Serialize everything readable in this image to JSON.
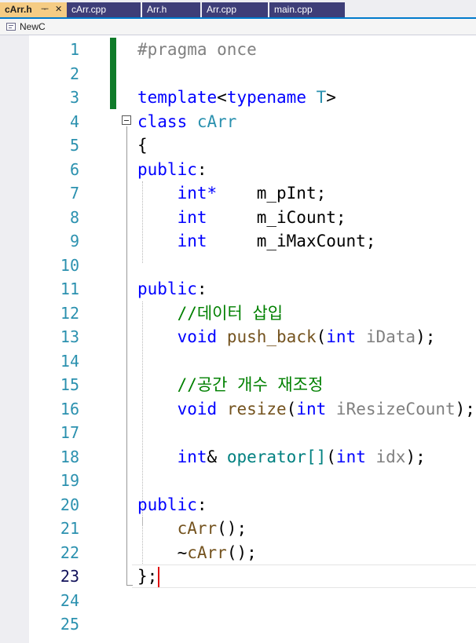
{
  "tabs": [
    {
      "label": "cArr.h",
      "pin": "ᅮ",
      "close": "✕",
      "active": true
    },
    {
      "label": "cArr.cpp",
      "active": false
    },
    {
      "label": "Arr.h",
      "active": false
    },
    {
      "label": "Arr.cpp",
      "active": false
    },
    {
      "label": "main.cpp",
      "active": false
    }
  ],
  "nav": {
    "scope": "NewC",
    "icon": "class-scope-icon"
  },
  "editor": {
    "current_line": 23,
    "line_numbers": [
      "1",
      "2",
      "3",
      "4",
      "5",
      "6",
      "7",
      "8",
      "9",
      "10",
      "11",
      "12",
      "13",
      "14",
      "15",
      "16",
      "17",
      "18",
      "19",
      "20",
      "21",
      "22",
      "23",
      "24",
      "25"
    ],
    "code": {
      "pragma": "#pragma once",
      "l3_template": "template",
      "l3_lt": "<",
      "l3_typename": "typename",
      "l3_T": "T",
      "l3_gt": ">",
      "l4_class": "class",
      "l4_name": "cArr",
      "l5": "{",
      "l6_public": "public",
      "colon": ":",
      "l7_type": "int*",
      "l7_name": "m_pInt;",
      "l8_type": "int",
      "l8_name": "m_iCount;",
      "l9_type": "int",
      "l9_name": "m_iMaxCount;",
      "l11_public": "public",
      "l12_comment": "//데이터 삽입",
      "l13_void": "void",
      "l13_fn": "push_back",
      "l13_open": "(",
      "l13_int": "int",
      "l13_param": "iData",
      "l13_close": ");",
      "l15_comment": "//공간 개수 재조정",
      "l16_void": "void",
      "l16_fn": "resize",
      "l16_open": "(",
      "l16_int": "int",
      "l16_param": "iResizeCount",
      "l16_close": ");",
      "l18_int": "int",
      "l18_amp": "&",
      "l18_op": "operator[]",
      "l18_open": "(",
      "l18_int2": "int",
      "l18_param": "idx",
      "l18_close": ");",
      "l20_public": "public",
      "l21_ctor": "cArr",
      "l21_rest": "();",
      "l22_tilde": "~",
      "l22_dtor": "cArr",
      "l22_rest": "();",
      "l23": "};"
    }
  },
  "colors": {
    "keyword": "#0000ff",
    "comment": "#008000",
    "type": "#2b91af",
    "active_tab": "#f5cc84",
    "inactive_tab": "#3e3e78",
    "change_bar": "#0f7b2a"
  }
}
